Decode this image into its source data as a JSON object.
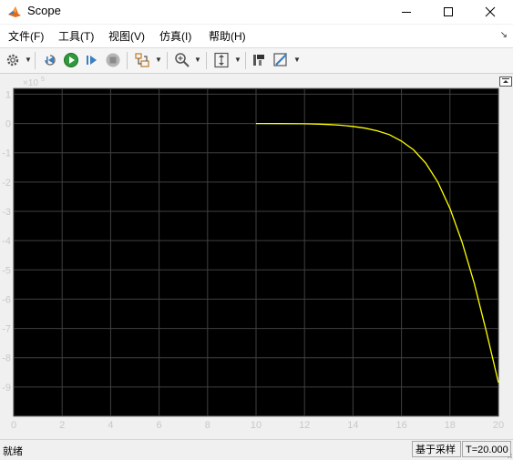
{
  "window": {
    "title": "Scope"
  },
  "menu": {
    "items": [
      {
        "label": "文件(F)"
      },
      {
        "label": "工具(T)"
      },
      {
        "label": "视图(V)"
      },
      {
        "label": "仿真(I)"
      },
      {
        "label": "帮助(H)"
      }
    ],
    "arrow": "↘"
  },
  "toolbar": {
    "icons": [
      "settings-icon",
      "step-back-icon",
      "run-icon",
      "step-forward-icon",
      "stop-icon",
      "signal-select-icon",
      "zoom-icon",
      "autoscale-icon",
      "highlight-icon",
      "style-icon"
    ]
  },
  "status": {
    "ready": "就绪",
    "mode": "基于采样",
    "time": "T=20.000"
  },
  "colors": {
    "plot_background": "#000000",
    "grid": "#404040",
    "trace": "#ffff00",
    "axis_text": "#c8c8c8"
  },
  "chart_data": {
    "type": "line",
    "title": "",
    "xlabel": "",
    "ylabel": "",
    "exponent_label": "×10",
    "exponent_power": "5",
    "xlim": [
      0,
      20
    ],
    "ylim": [
      -10,
      1
    ],
    "grid": true,
    "xticks": [
      "0",
      "2",
      "4",
      "6",
      "8",
      "10",
      "12",
      "14",
      "16",
      "18",
      "20"
    ],
    "yticks": [
      "1",
      "0",
      "-1",
      "-2",
      "-3",
      "-4",
      "-5",
      "-6",
      "-7",
      "-8",
      "-9"
    ],
    "series": [
      {
        "x": [
          10,
          11,
          12,
          12.5,
          13,
          13.5,
          14,
          14.5,
          15,
          15.5,
          16,
          16.5,
          17,
          17.5,
          18,
          18.5,
          19,
          19.5,
          20
        ],
        "y": [
          0,
          -0.003,
          -0.01,
          -0.02,
          -0.035,
          -0.06,
          -0.1,
          -0.16,
          -0.25,
          -0.38,
          -0.6,
          -0.9,
          -1.35,
          -2.0,
          -2.9,
          -4.05,
          -5.45,
          -7.1,
          -8.85
        ]
      }
    ]
  }
}
